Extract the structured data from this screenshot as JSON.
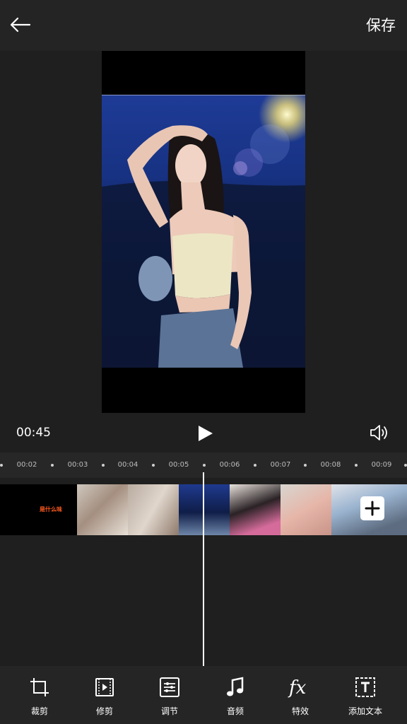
{
  "header": {
    "save_label": "保存",
    "back_icon": "arrow-left-icon"
  },
  "player": {
    "current_time": "00:45",
    "play_icon": "play-icon",
    "volume_icon": "volume-icon"
  },
  "timeline": {
    "ticks": [
      "00:02",
      "00:03",
      "00:04",
      "00:05",
      "00:06",
      "00:07",
      "00:08",
      "00:09"
    ],
    "title_clip_text": "是什么味",
    "add_icon": "plus-icon"
  },
  "toolbar": {
    "items": [
      {
        "label": "裁剪",
        "icon": "crop-icon"
      },
      {
        "label": "修剪",
        "icon": "trim-icon"
      },
      {
        "label": "调节",
        "icon": "adjust-icon"
      },
      {
        "label": "音频",
        "icon": "music-note-icon"
      },
      {
        "label": "特效",
        "icon": "fx-icon"
      },
      {
        "label": "添加文本",
        "icon": "text-icon"
      }
    ]
  },
  "colors": {
    "accent": "#ffffff",
    "background": "#1f1f1f",
    "title_text": "#ff5a1f"
  }
}
